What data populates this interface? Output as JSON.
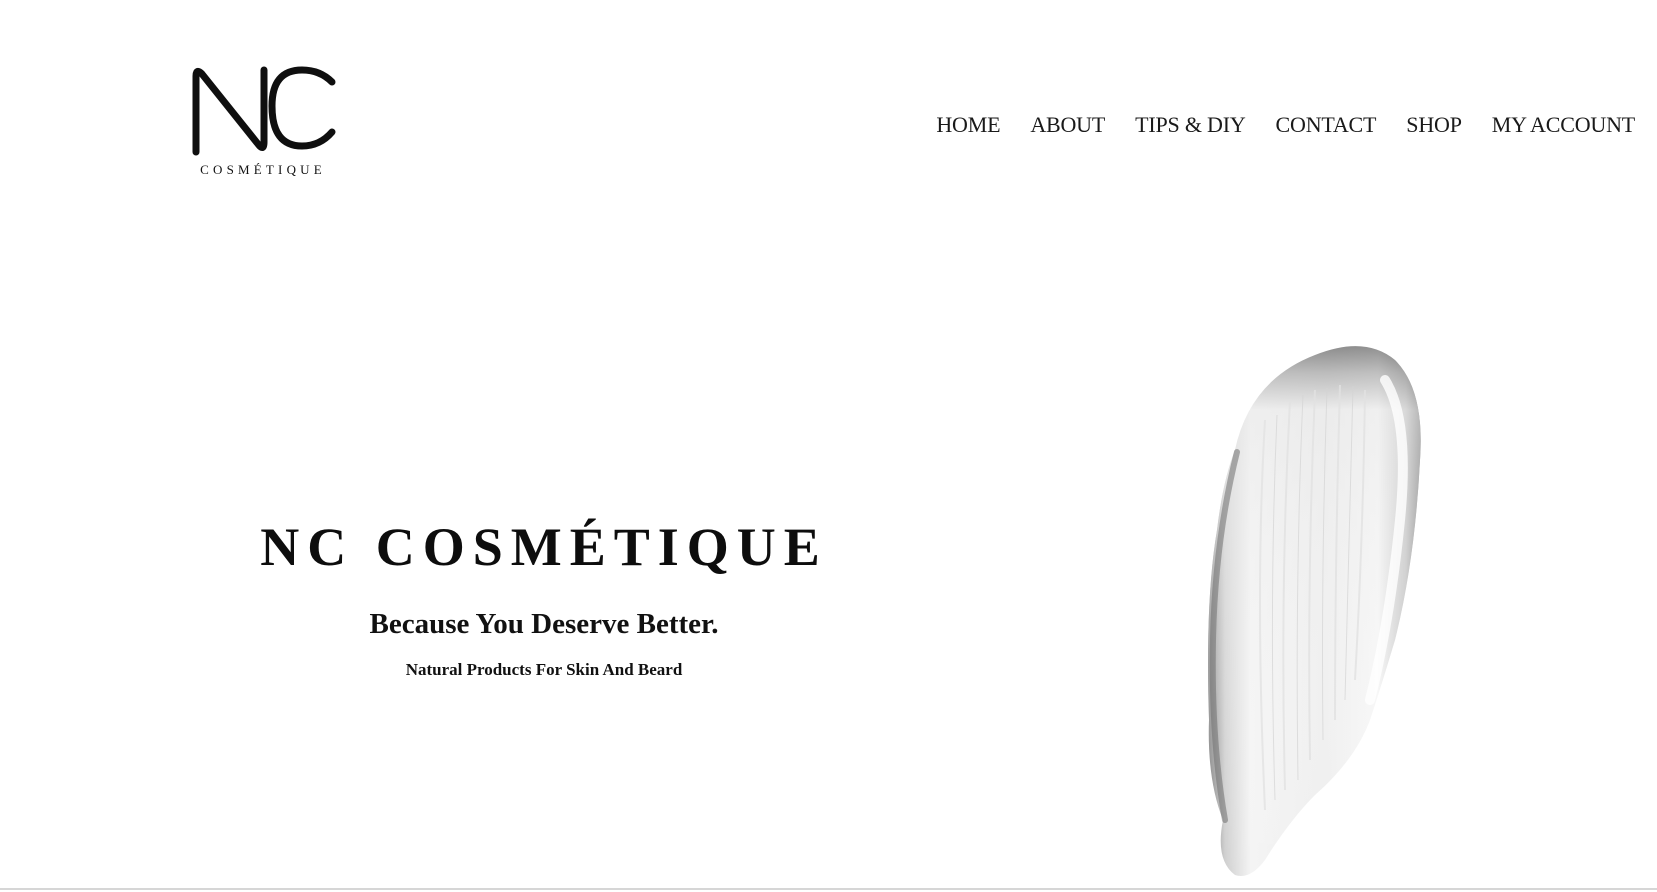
{
  "brand": {
    "logo_letters": "NC",
    "logo_wordmark": "COSMÉTIQUE"
  },
  "nav": {
    "items": [
      {
        "label": "HOME"
      },
      {
        "label": "ABOUT"
      },
      {
        "label": "TIPS & DIY"
      },
      {
        "label": "CONTACT"
      },
      {
        "label": "SHOP"
      },
      {
        "label": "MY ACCOUNT"
      }
    ]
  },
  "hero": {
    "title": "NC COSMÉTIQUE",
    "subtitle": "Because You Deserve Better.",
    "tagline": "Natural Products For Skin And Beard",
    "image_icon": "cream-swatch"
  },
  "colors": {
    "background": "#ffffff",
    "text": "#111111",
    "cream": "#f1f1f1",
    "cream_shadow": "#8a8a8a"
  }
}
